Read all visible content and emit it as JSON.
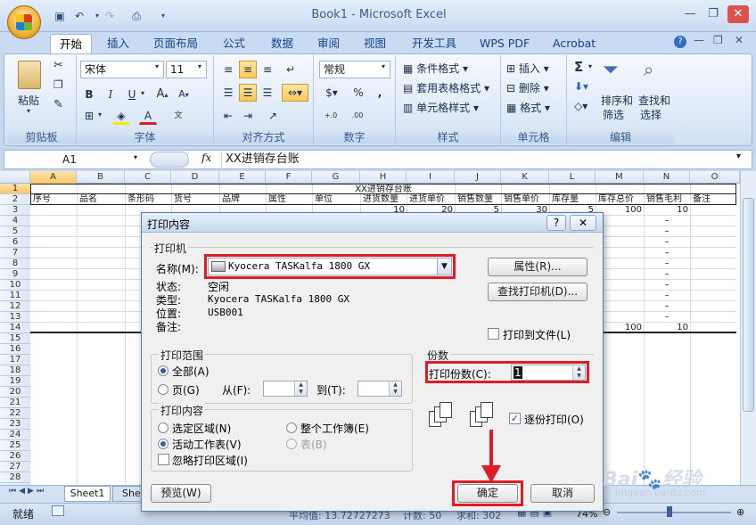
{
  "window": {
    "title": "Book1 - Microsoft Excel"
  },
  "ribbon_tabs": [
    "开始",
    "插入",
    "页面布局",
    "公式",
    "数据",
    "审阅",
    "视图",
    "开发工具",
    "WPS PDF",
    "Acrobat"
  ],
  "ribbon": {
    "clipboard": {
      "paste": "粘贴",
      "label": "剪贴板"
    },
    "font": {
      "name": "宋体",
      "size": "11",
      "label": "字体",
      "bold": "B",
      "italic": "I",
      "underline": "U"
    },
    "alignment": {
      "label": "对齐方式"
    },
    "number": {
      "format": "常规",
      "label": "数字",
      "percent": "%",
      "comma": ","
    },
    "styles": {
      "conditional": "条件格式",
      "table": "套用表格格式",
      "cell": "单元格样式",
      "label": "样式"
    },
    "cells": {
      "insert": "插入",
      "delete": "删除",
      "format": "格式",
      "label": "单元格"
    },
    "editing": {
      "sort": "排序和",
      "sort2": "筛选",
      "find": "查找和",
      "find2": "选择",
      "label": "编辑",
      "sum": "Σ"
    }
  },
  "formula_bar": {
    "name_box": "A1",
    "fx": "fx",
    "content": "XX进销存台账"
  },
  "columns": [
    "A",
    "B",
    "C",
    "D",
    "E",
    "F",
    "G",
    "H",
    "I",
    "J",
    "K",
    "L",
    "M",
    "N",
    "O"
  ],
  "rows": [
    "1",
    "2",
    "3",
    "4",
    "5",
    "6",
    "7",
    "8",
    "9",
    "10",
    "11",
    "12",
    "13",
    "14",
    "15",
    "16",
    "17",
    "18",
    "19",
    "20",
    "21",
    "22",
    "23",
    "24",
    "25",
    "26",
    "27",
    "28"
  ],
  "sheet": {
    "title": "XX进销存台账",
    "headers": [
      "序号",
      "品名",
      "条形码",
      "货号",
      "品牌",
      "属性",
      "单位",
      "进货数量",
      "进货单价",
      "销售数量",
      "销售单价",
      "库存量",
      "库存总价",
      "销售毛利",
      "备注"
    ],
    "row3": {
      "h": "10",
      "i": "20",
      "j": "5",
      "k": "30",
      "l": "5",
      "m": "100",
      "n": "10"
    },
    "dash": "–",
    "row13": {
      "m": "100",
      "n": "10"
    }
  },
  "sheet_tabs": [
    "Sheet1",
    "She"
  ],
  "status": {
    "mode": "就绪",
    "average": "平均值: 13.72727273",
    "count": "计数: 50",
    "sum": "求和: 302",
    "zoom": "74%"
  },
  "dialog": {
    "title": "打印内容",
    "help": "?",
    "close": "✕",
    "printer_group": "打印机",
    "name_label": "名称(M):",
    "printer_name": "Kyocera TASKalfa 1800 GX",
    "properties_btn": "属性(R)...",
    "find_printer_btn": "查找打印机(D)...",
    "status_label": "状态:",
    "status_value": "空闲",
    "type_label": "类型:",
    "type_value": "Kyocera TASKalfa 1800 GX",
    "where_label": "位置:",
    "where_value": "USB001",
    "comment_label": "备注:",
    "print_to_file": "打印到文件(L)",
    "range_group": "打印范围",
    "all": "全部(A)",
    "pages": "页(G)",
    "from": "从(F):",
    "to": "到(T):",
    "content_group": "打印内容",
    "selection": "选定区域(N)",
    "whole_book": "整个工作簿(E)",
    "active_sheet": "活动工作表(V)",
    "table": "表(B)",
    "ignore_area": "忽略打印区域(I)",
    "copies_group": "份数",
    "copies_label": "打印份数(C):",
    "copies_value": "1",
    "collate": "逐份打印(O)",
    "preview_btn": "预览(W)",
    "ok_btn": "确定",
    "cancel_btn": "取消"
  },
  "watermark": {
    "brand": "Bai",
    "brand2": "经验",
    "url": "jingyan.baidu.com"
  }
}
